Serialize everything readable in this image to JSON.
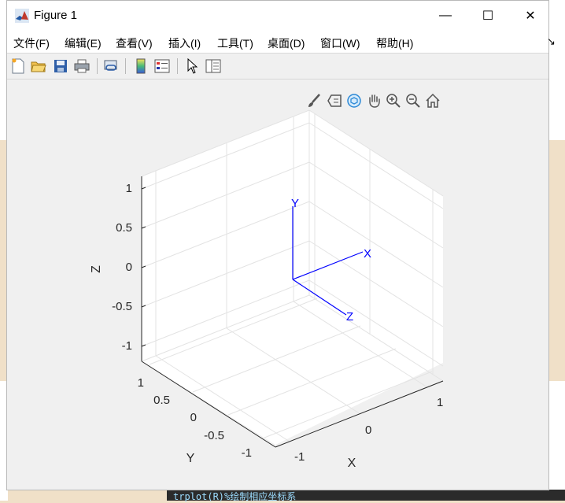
{
  "window": {
    "title": "Figure 1",
    "minimize": "—",
    "maximize": "☐",
    "close": "✕"
  },
  "menu": [
    {
      "label": "文件(F)"
    },
    {
      "label": "编辑(E)"
    },
    {
      "label": "查看(V)"
    },
    {
      "label": "插入(I)"
    },
    {
      "label": "工具(T)"
    },
    {
      "label": "桌面(D)"
    },
    {
      "label": "窗口(W)"
    },
    {
      "label": "帮助(H)"
    }
  ],
  "toolbar": [
    "new-figure-icon",
    "open-file-icon",
    "save-icon",
    "print-icon",
    "link-plot-icon",
    "colorbar-icon",
    "legend-icon",
    "pointer-icon",
    "property-inspector-icon"
  ],
  "axes_toolbar": [
    "brush-icon",
    "data-tip-icon",
    "rotate-3d-icon",
    "pan-icon",
    "zoom-in-icon",
    "zoom-out-icon",
    "home-icon"
  ],
  "plot": {
    "z_label": "Z",
    "x_label": "X",
    "y_label": "Y",
    "z_ticks": [
      "1",
      "0.5",
      "0",
      "-0.5",
      "-1"
    ],
    "x_ticks": [
      "1",
      "0",
      "-1"
    ],
    "y_ticks": [
      "1",
      "0.5",
      "0",
      "-0.5",
      "-1"
    ],
    "frame_labels": {
      "x": "X",
      "y": "Y",
      "z": "Z"
    },
    "frame_color": "#0000ff"
  },
  "background": {
    "bottom_code": "trplot(R)%绘制相应坐标系"
  }
}
